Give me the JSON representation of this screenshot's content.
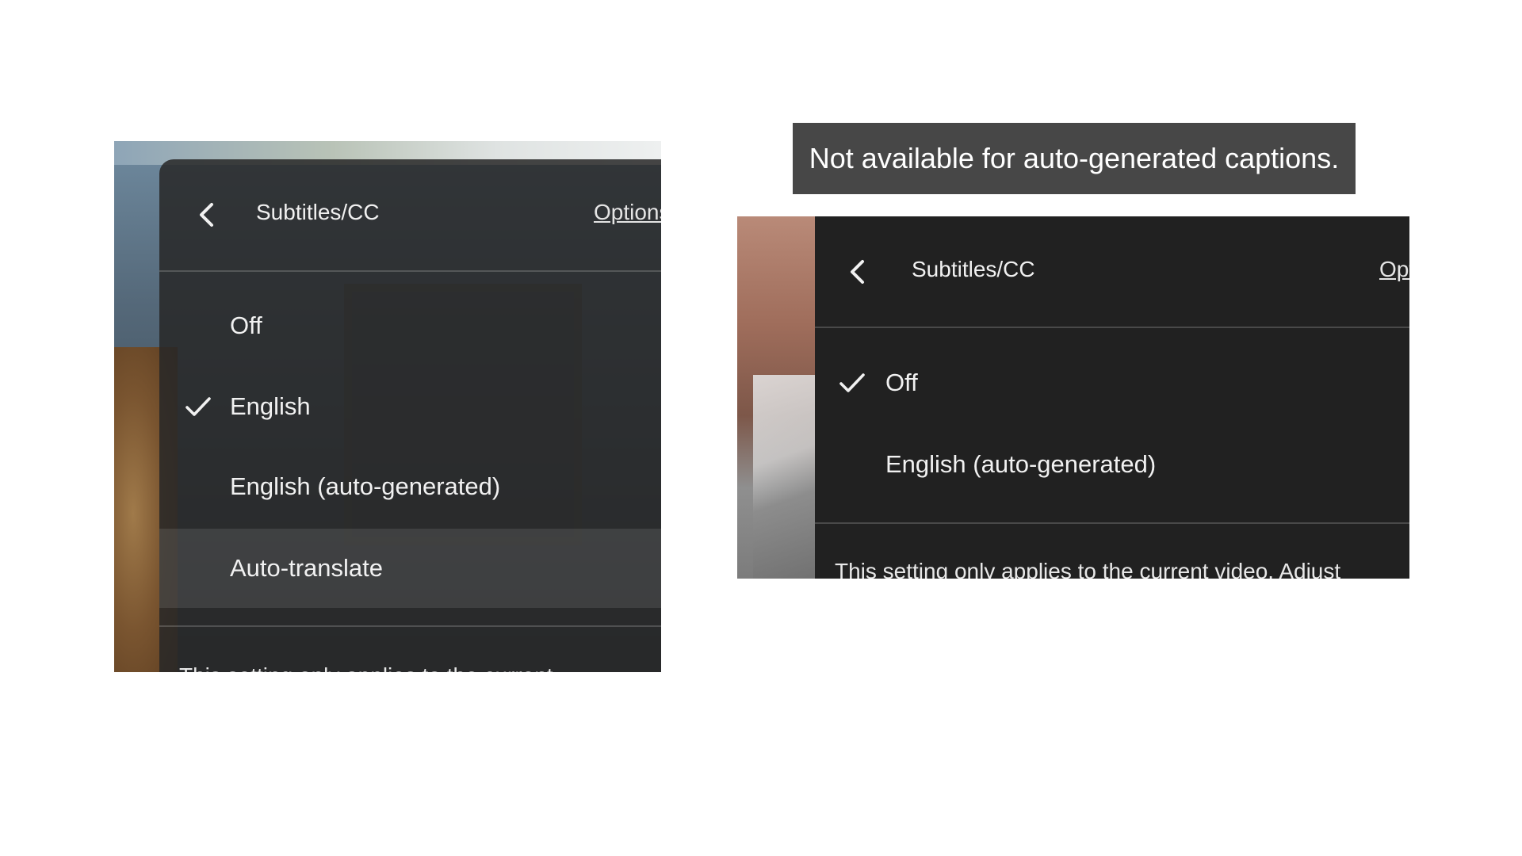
{
  "left_panel": {
    "title": "Subtitles/CC",
    "options_label": "Options",
    "items": [
      {
        "label": "Off",
        "checked": false
      },
      {
        "label": "English",
        "checked": true
      },
      {
        "label": "English (auto-generated)",
        "checked": false
      },
      {
        "label": "Auto-translate",
        "checked": false,
        "highlighted": true
      }
    ],
    "footnote": "This setting only applies to the current"
  },
  "tooltip": {
    "text": "Not available for auto-generated captions."
  },
  "right_panel": {
    "title": "Subtitles/CC",
    "options_label": "Options",
    "items": [
      {
        "label": "Off",
        "checked": true
      },
      {
        "label": "English (auto-generated)",
        "checked": false
      }
    ],
    "footnote": "This setting only applies to the current video. Adjust"
  },
  "icons": {
    "back": "chevron-left-icon",
    "check": "check-icon"
  }
}
